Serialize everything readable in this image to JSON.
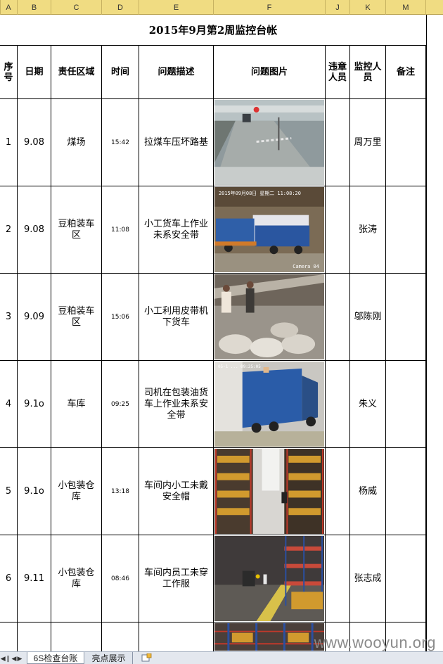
{
  "column_headers": [
    "A",
    "B",
    "C",
    "D",
    "E",
    "F",
    "J",
    "K",
    "M"
  ],
  "title": "2015年9月第2周监控台帐",
  "table_headers": {
    "seq": "序号",
    "date": "日期",
    "area": "责任区域",
    "time": "时间",
    "desc": "问题描述",
    "photo": "问题图片",
    "violator": "违章人员",
    "monitor": "监控人员",
    "remark": "备注"
  },
  "rows": [
    {
      "seq": "1",
      "date": "9.08",
      "area": "煤场",
      "time": "15:42",
      "desc": "拉煤车压坏路基",
      "photo": "road-gate-camera-photo",
      "violator": "",
      "monitor": "周万里",
      "remark": ""
    },
    {
      "seq": "2",
      "date": "9.08",
      "area": "豆粕装车区",
      "time": "11:08",
      "desc": "小工货车上作业未系安全带",
      "photo": "truck-loading-camera-photo",
      "photo_stamp": "2015年09月08日 星期二 11:08:20",
      "photo_cam": "Camera 04",
      "violator": "",
      "monitor": "张涛",
      "remark": ""
    },
    {
      "seq": "3",
      "date": "9.09",
      "area": "豆粕装车区",
      "time": "15:06",
      "desc": "小工利用皮带机下货车",
      "photo": "conveyor-belt-camera-photo",
      "violator": "",
      "monitor": "邬陈刚",
      "remark": ""
    },
    {
      "seq": "4",
      "date": "9.1o",
      "area": "车库",
      "time": "09:25",
      "desc": "司机在包装油货车上作业未系安全带",
      "photo": "oil-truck-camera-photo",
      "photo_stamp": "05-1 ... 09:25:05",
      "violator": "",
      "monitor": "朱义",
      "remark": ""
    },
    {
      "seq": "5",
      "date": "9.1o",
      "area": "小包装仓库",
      "time": "13:18",
      "desc": "车间内小工未戴安全帽",
      "photo": "warehouse-racks-camera-photo",
      "violator": "",
      "monitor": "杨威",
      "remark": ""
    },
    {
      "seq": "6",
      "date": "9.11",
      "area": "小包装仓库",
      "time": "08:46",
      "desc": "车间内员工未穿工作服",
      "photo": "warehouse-forklift-camera-photo",
      "violator": "",
      "monitor": "张志成",
      "remark": ""
    },
    {
      "seq": "",
      "date": "",
      "area": "",
      "time": "",
      "desc": "",
      "photo": "warehouse-partial-camera-photo",
      "violator": "",
      "monitor": "",
      "remark": ""
    }
  ],
  "sheet_tabs": [
    "6S检查台账",
    "亮点展示"
  ],
  "watermark": "www.wooyun.org",
  "colors": {
    "column_header_bg": "#f0dc82",
    "tab_bar_bg": "#e3e7ee",
    "grid_line": "#000000"
  }
}
